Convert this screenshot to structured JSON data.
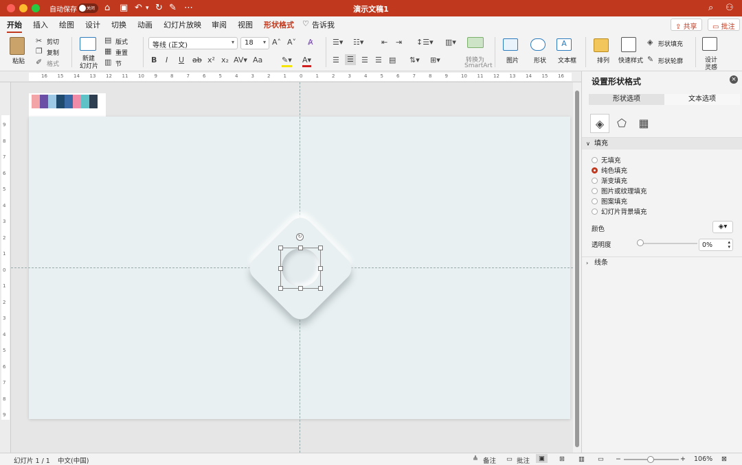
{
  "titlebar": {
    "autosave_label": "自动保存",
    "autosave_toggle": "关闭",
    "doc_title": "演示文稿1",
    "more": "⋯"
  },
  "tabs": {
    "items": [
      "开始",
      "插入",
      "绘图",
      "设计",
      "切换",
      "动画",
      "幻灯片放映",
      "审阅",
      "视图",
      "形状格式"
    ],
    "tell_me": "告诉我",
    "share": "共享",
    "comments": "批注"
  },
  "ribbon": {
    "paste": "粘贴",
    "cut": "剪切",
    "copy": "复制",
    "format_painter": "格式",
    "new_slide_1": "新建",
    "new_slide_2": "幻灯片",
    "layout": "版式",
    "reset": "重置",
    "section": "节",
    "font_name": "等线 (正文)",
    "font_size": "18",
    "bold": "B",
    "italic": "I",
    "underline": "U",
    "strike": "ab",
    "superscript": "x²",
    "subscript": "x₂",
    "case": "Aa",
    "convert_smartart_1": "转换为",
    "convert_smartart_2": "SmartArt",
    "picture": "图片",
    "shape": "形状",
    "textbox": "文本框",
    "arrange": "排列",
    "quick_styles": "快速样式",
    "shape_fill": "形状填充",
    "shape_outline": "形状轮廓",
    "designer_1": "设计",
    "designer_2": "灵感"
  },
  "ruler": {
    "h_ticks": [
      "16",
      "15",
      "14",
      "13",
      "12",
      "11",
      "10",
      "9",
      "8",
      "7",
      "6",
      "5",
      "4",
      "3",
      "2",
      "1",
      "0",
      "1",
      "2",
      "3",
      "4",
      "5",
      "6",
      "7",
      "8",
      "9",
      "10",
      "11",
      "12",
      "13",
      "14",
      "15",
      "16"
    ],
    "v_ticks": [
      "9",
      "8",
      "7",
      "6",
      "5",
      "4",
      "3",
      "2",
      "1",
      "0",
      "1",
      "2",
      "3",
      "4",
      "5",
      "6",
      "7",
      "8",
      "9"
    ]
  },
  "swatches": [
    "#f3a4a6",
    "#6b4ea6",
    "#9ec9e6",
    "#1f4a6e",
    "#3a6aa5",
    "#f08ba8",
    "#5fc2c6",
    "#2c3e50"
  ],
  "pane": {
    "title": "设置形状格式",
    "tab_shape": "形状选项",
    "tab_text": "文本选项",
    "fill_section": "填充",
    "fill_options": [
      "无填充",
      "纯色填充",
      "渐变填充",
      "图片或纹理填充",
      "图案填充",
      "幻灯片背景填充"
    ],
    "selected_fill_index": 1,
    "color_label": "颜色",
    "transparency_label": "透明度",
    "transparency_value": "0%",
    "transparency_level": 0,
    "line_section": "线条"
  },
  "status": {
    "slide": "幻灯片 1 / 1",
    "language": "中文(中国)",
    "notes": "备注",
    "comments": "批注",
    "zoom": "106%"
  },
  "colors": {
    "accent": "#c0391f",
    "slide_bg": "#e8f0f1"
  }
}
